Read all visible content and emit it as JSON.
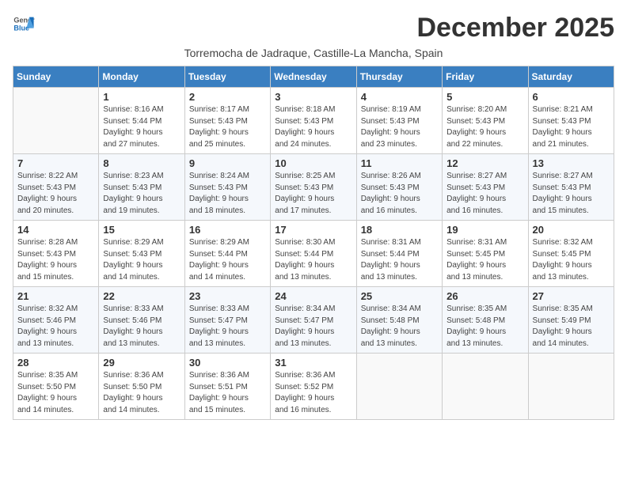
{
  "logo": {
    "general": "General",
    "blue": "Blue"
  },
  "title": "December 2025",
  "subtitle": "Torremocha de Jadraque, Castille-La Mancha, Spain",
  "days_of_week": [
    "Sunday",
    "Monday",
    "Tuesday",
    "Wednesday",
    "Thursday",
    "Friday",
    "Saturday"
  ],
  "weeks": [
    [
      {
        "day": "",
        "info": ""
      },
      {
        "day": "1",
        "info": "Sunrise: 8:16 AM\nSunset: 5:44 PM\nDaylight: 9 hours\nand 27 minutes."
      },
      {
        "day": "2",
        "info": "Sunrise: 8:17 AM\nSunset: 5:43 PM\nDaylight: 9 hours\nand 25 minutes."
      },
      {
        "day": "3",
        "info": "Sunrise: 8:18 AM\nSunset: 5:43 PM\nDaylight: 9 hours\nand 24 minutes."
      },
      {
        "day": "4",
        "info": "Sunrise: 8:19 AM\nSunset: 5:43 PM\nDaylight: 9 hours\nand 23 minutes."
      },
      {
        "day": "5",
        "info": "Sunrise: 8:20 AM\nSunset: 5:43 PM\nDaylight: 9 hours\nand 22 minutes."
      },
      {
        "day": "6",
        "info": "Sunrise: 8:21 AM\nSunset: 5:43 PM\nDaylight: 9 hours\nand 21 minutes."
      }
    ],
    [
      {
        "day": "7",
        "info": "Sunrise: 8:22 AM\nSunset: 5:43 PM\nDaylight: 9 hours\nand 20 minutes."
      },
      {
        "day": "8",
        "info": "Sunrise: 8:23 AM\nSunset: 5:43 PM\nDaylight: 9 hours\nand 19 minutes."
      },
      {
        "day": "9",
        "info": "Sunrise: 8:24 AM\nSunset: 5:43 PM\nDaylight: 9 hours\nand 18 minutes."
      },
      {
        "day": "10",
        "info": "Sunrise: 8:25 AM\nSunset: 5:43 PM\nDaylight: 9 hours\nand 17 minutes."
      },
      {
        "day": "11",
        "info": "Sunrise: 8:26 AM\nSunset: 5:43 PM\nDaylight: 9 hours\nand 16 minutes."
      },
      {
        "day": "12",
        "info": "Sunrise: 8:27 AM\nSunset: 5:43 PM\nDaylight: 9 hours\nand 16 minutes."
      },
      {
        "day": "13",
        "info": "Sunrise: 8:27 AM\nSunset: 5:43 PM\nDaylight: 9 hours\nand 15 minutes."
      }
    ],
    [
      {
        "day": "14",
        "info": "Sunrise: 8:28 AM\nSunset: 5:43 PM\nDaylight: 9 hours\nand 15 minutes."
      },
      {
        "day": "15",
        "info": "Sunrise: 8:29 AM\nSunset: 5:43 PM\nDaylight: 9 hours\nand 14 minutes."
      },
      {
        "day": "16",
        "info": "Sunrise: 8:29 AM\nSunset: 5:44 PM\nDaylight: 9 hours\nand 14 minutes."
      },
      {
        "day": "17",
        "info": "Sunrise: 8:30 AM\nSunset: 5:44 PM\nDaylight: 9 hours\nand 13 minutes."
      },
      {
        "day": "18",
        "info": "Sunrise: 8:31 AM\nSunset: 5:44 PM\nDaylight: 9 hours\nand 13 minutes."
      },
      {
        "day": "19",
        "info": "Sunrise: 8:31 AM\nSunset: 5:45 PM\nDaylight: 9 hours\nand 13 minutes."
      },
      {
        "day": "20",
        "info": "Sunrise: 8:32 AM\nSunset: 5:45 PM\nDaylight: 9 hours\nand 13 minutes."
      }
    ],
    [
      {
        "day": "21",
        "info": "Sunrise: 8:32 AM\nSunset: 5:46 PM\nDaylight: 9 hours\nand 13 minutes."
      },
      {
        "day": "22",
        "info": "Sunrise: 8:33 AM\nSunset: 5:46 PM\nDaylight: 9 hours\nand 13 minutes."
      },
      {
        "day": "23",
        "info": "Sunrise: 8:33 AM\nSunset: 5:47 PM\nDaylight: 9 hours\nand 13 minutes."
      },
      {
        "day": "24",
        "info": "Sunrise: 8:34 AM\nSunset: 5:47 PM\nDaylight: 9 hours\nand 13 minutes."
      },
      {
        "day": "25",
        "info": "Sunrise: 8:34 AM\nSunset: 5:48 PM\nDaylight: 9 hours\nand 13 minutes."
      },
      {
        "day": "26",
        "info": "Sunrise: 8:35 AM\nSunset: 5:48 PM\nDaylight: 9 hours\nand 13 minutes."
      },
      {
        "day": "27",
        "info": "Sunrise: 8:35 AM\nSunset: 5:49 PM\nDaylight: 9 hours\nand 14 minutes."
      }
    ],
    [
      {
        "day": "28",
        "info": "Sunrise: 8:35 AM\nSunset: 5:50 PM\nDaylight: 9 hours\nand 14 minutes."
      },
      {
        "day": "29",
        "info": "Sunrise: 8:36 AM\nSunset: 5:50 PM\nDaylight: 9 hours\nand 14 minutes."
      },
      {
        "day": "30",
        "info": "Sunrise: 8:36 AM\nSunset: 5:51 PM\nDaylight: 9 hours\nand 15 minutes."
      },
      {
        "day": "31",
        "info": "Sunrise: 8:36 AM\nSunset: 5:52 PM\nDaylight: 9 hours\nand 16 minutes."
      },
      {
        "day": "",
        "info": ""
      },
      {
        "day": "",
        "info": ""
      },
      {
        "day": "",
        "info": ""
      }
    ]
  ]
}
